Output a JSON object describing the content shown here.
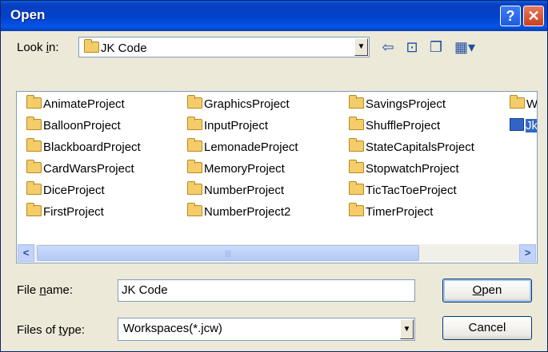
{
  "window": {
    "title": "Open",
    "help_glyph": "?",
    "close_glyph": "✕"
  },
  "lookin": {
    "label_pre": "Look ",
    "label_ul": "i",
    "label_post": "n:",
    "value": "JK Code"
  },
  "toolbar": {
    "back_icon": "back-arrow-icon",
    "up_icon": "up-folder-icon",
    "new_icon": "new-folder-icon",
    "view_icon": "view-menu-icon"
  },
  "files": {
    "col1": [
      "AnimateProject",
      "BalloonProject",
      "BlackboardProject",
      "CardWarsProject",
      "DiceProject",
      "FirstProject"
    ],
    "col2": [
      "GraphicsProject",
      "InputProject",
      "LemonadeProject",
      "MemoryProject",
      "NumberProject",
      "NumberProject2"
    ],
    "col3": [
      "SavingsProject",
      "ShuffleProject",
      "StateCapitalsProject",
      "StopwatchProject",
      "TicTacToeProject",
      "TimerProject"
    ],
    "col4": [
      "W",
      "Jk"
    ]
  },
  "filename": {
    "label_pre": "File ",
    "label_ul": "n",
    "label_post": "ame:",
    "value": "JK Code"
  },
  "filetype": {
    "label_pre": "Files of ",
    "label_ul": "t",
    "label_post": "ype:",
    "value": "Workspaces(*.jcw)"
  },
  "buttons": {
    "open_ul": "O",
    "open_rest": "pen",
    "cancel": "Cancel"
  },
  "colors": {
    "titlebar": "#0340C9",
    "selection": "#316AC5",
    "face": "#ECE9D8"
  }
}
